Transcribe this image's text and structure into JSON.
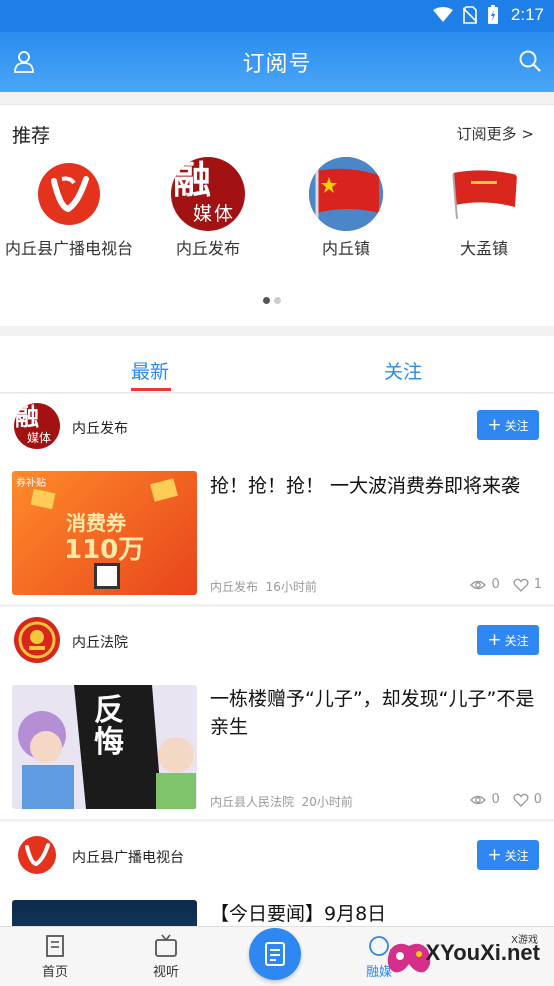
{
  "status_bar": {
    "time": "2:17"
  },
  "header": {
    "title": "订阅号"
  },
  "recommend": {
    "title": "推荐",
    "more": "订阅更多 >",
    "items": [
      {
        "label": "内丘县广播电视台"
      },
      {
        "label": "内丘发布"
      },
      {
        "label": "内丘镇"
      },
      {
        "label": "大孟镇"
      }
    ],
    "logo_text_rong": "融",
    "logo_text_media": "媒体"
  },
  "tabs": [
    {
      "label": "最新"
    },
    {
      "label": "关注"
    }
  ],
  "follow_label": "关注",
  "feed": [
    {
      "source": "内丘发布",
      "headline": "抢！抢！抢！ 一大波消费券即将来袭",
      "meta_source": "内丘发布",
      "meta_time": "16小时前",
      "views": "0",
      "likes": "1",
      "thumb_text_top": "券补贴",
      "thumb_text_main": "消费券",
      "thumb_text_amount": "110万"
    },
    {
      "source": "内丘法院",
      "headline": "一栋楼赠予“儿子”，却发现“儿子”不是亲生",
      "meta_source": "内丘县人民法院",
      "meta_time": "20小时前",
      "views": "0",
      "likes": "0",
      "thumb_text": "反悔"
    },
    {
      "source": "内丘县广播电视台",
      "headline": "【今日要闻】9月8日"
    }
  ],
  "bottom_nav": [
    {
      "label": "首页"
    },
    {
      "label": "视听"
    },
    {
      "label": "融媒"
    }
  ],
  "watermark": {
    "brand": "XYouXi.net",
    "small": "X游戏"
  },
  "colors": {
    "accent": "#2f87f2",
    "header": "#1e7fe8",
    "tab_underline": "#e53935"
  }
}
